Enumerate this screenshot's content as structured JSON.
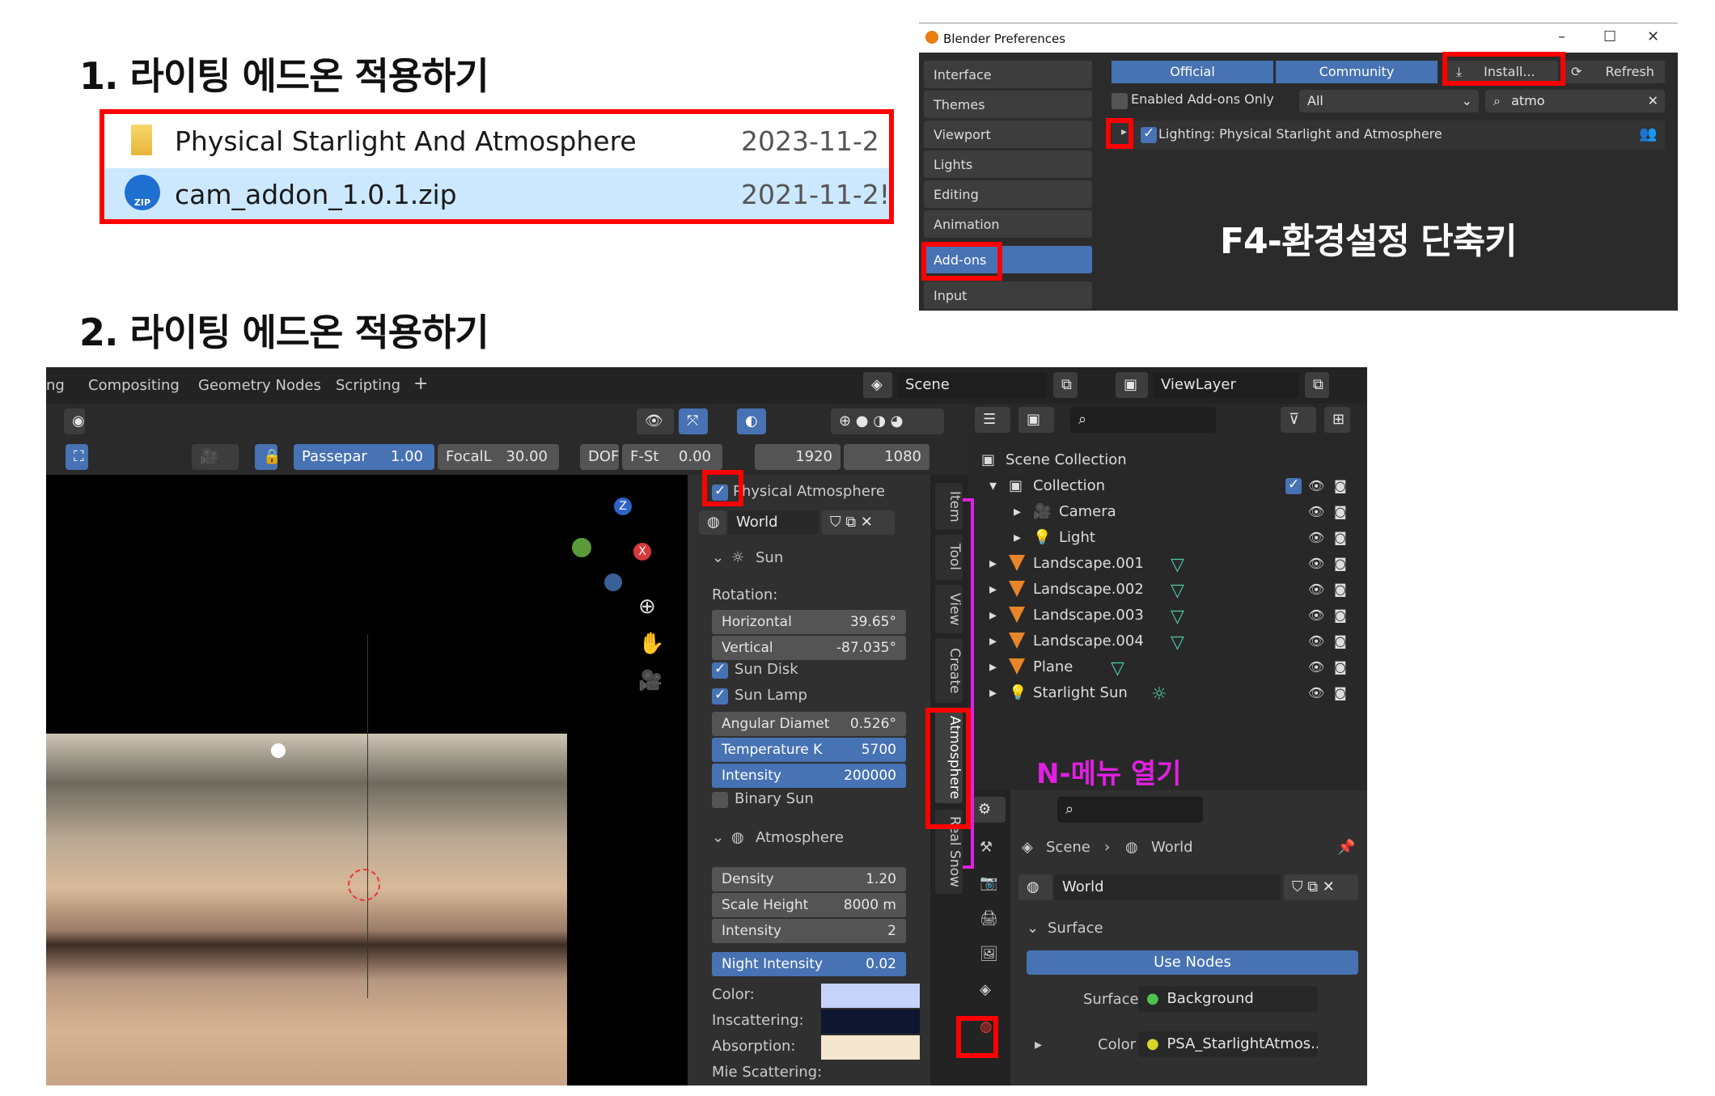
{
  "step1": {
    "title": "1. 라이팅 에드온 적용하기"
  },
  "step2": {
    "title": "2. 라이팅 에드온 적용하기"
  },
  "explorer": {
    "rows": [
      {
        "name": "Physical Starlight And Atmosphere",
        "date": "2023-11-2"
      },
      {
        "name": "cam_addon_1.0.1.zip",
        "date": "2021-11-2!"
      }
    ]
  },
  "prefs": {
    "title": "Blender Preferences",
    "sidebar": [
      "Interface",
      "Themes",
      "Viewport",
      "Lights",
      "Editing",
      "Animation",
      "Add-ons",
      "Input"
    ],
    "tabs": {
      "official": "Official",
      "community": "Community"
    },
    "install": "Install...",
    "refresh": "Refresh",
    "enabled_only": "Enabled Add-ons Only",
    "category": "All",
    "search": "atmo",
    "addon": "Lighting: Physical Starlight and Atmosphere",
    "annotation": "F4-환경설정 단축키"
  },
  "blender": {
    "workspaces": [
      "ng",
      "Compositing",
      "Geometry Nodes",
      "Scripting"
    ],
    "scene": "Scene",
    "viewlayer": "ViewLayer",
    "camera_bar": {
      "passepar_label": "Passepar",
      "passepar": "1.00",
      "focal_label": "FocalL",
      "focal": "30.00",
      "dof": "DOF",
      "fst_label": "F-St",
      "fst": "0.00",
      "res_x": "1920",
      "res_y": "1080"
    },
    "npanel": {
      "title": "Physical Atmosphere",
      "world": "World",
      "sun_section": "Sun",
      "rotation_label": "Rotation:",
      "horizontal_label": "Horizontal",
      "horizontal": "39.65°",
      "vertical_label": "Vertical",
      "vertical": "-87.035°",
      "sun_disk": "Sun Disk",
      "sun_lamp": "Sun Lamp",
      "angular_label": "Angular Diamet",
      "angular": "0.526°",
      "temp_label": "Temperature K",
      "temp": "5700",
      "intensity_label": "Intensity",
      "intensity": "200000",
      "binary_sun": "Binary Sun",
      "atmosphere_section": "Atmosphere",
      "density_label": "Density",
      "density": "1.20",
      "scale_height_label": "Scale Height",
      "scale_height": "8000 m",
      "atm_intensity_label": "Intensity",
      "atm_intensity": "2",
      "night_label": "Night Intensity",
      "night": "0.02",
      "color_label": "Color:",
      "inscattering_label": "Inscattering:",
      "absorption_label": "Absorption:",
      "mie_label": "Mie Scattering:"
    },
    "vtabs": [
      "Item",
      "Tool",
      "View",
      "Create",
      "Atmosphere",
      "Real Snow"
    ],
    "n_annotation": "N-메뉴 열기",
    "outliner": {
      "root": "Scene Collection",
      "collection": "Collection",
      "items": [
        "Camera",
        "Light",
        "Landscape.001",
        "Landscape.002",
        "Landscape.003",
        "Landscape.004",
        "Plane",
        "Starlight Sun"
      ]
    },
    "properties": {
      "breadcrumb_scene": "Scene",
      "breadcrumb_world": "World",
      "world": "World",
      "surface_section": "Surface",
      "use_nodes": "Use Nodes",
      "surface_label": "Surface",
      "surface_value": "Background",
      "color_label": "Color",
      "color_value": "PSA_StarlightAtmos..."
    },
    "colors": {
      "accent": "#4772b3",
      "highlight": "#ff0000",
      "annotation": "#e020e0"
    }
  }
}
